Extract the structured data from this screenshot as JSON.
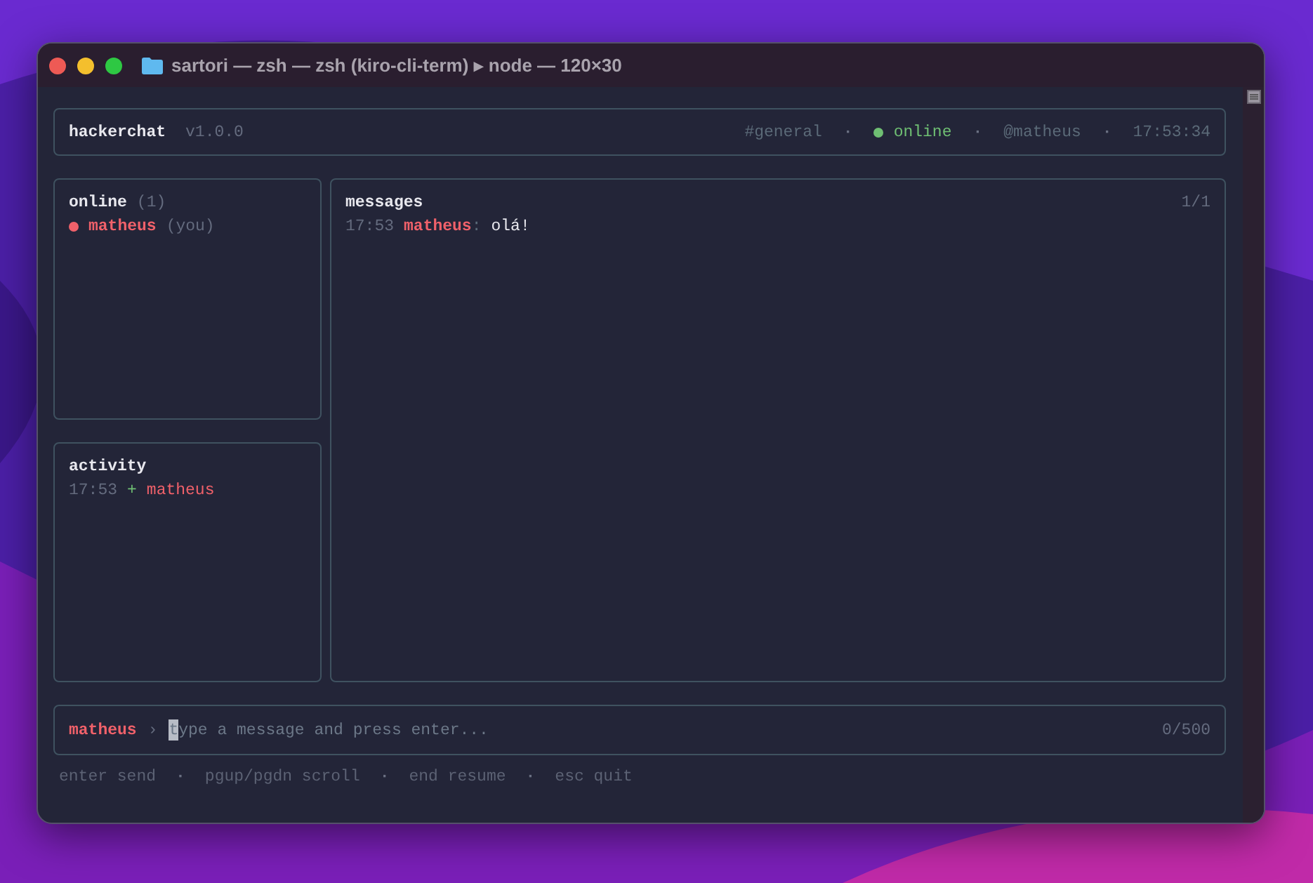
{
  "window": {
    "title": "sartori — zsh — zsh (kiro-cli-term) ▸ node — 120×30"
  },
  "header": {
    "app_name": "hackerchat",
    "version": "v1.0.0",
    "channel": "#general",
    "separator_1": "·",
    "status": "online",
    "status_on": true,
    "separator_2": "·",
    "user": "@matheus",
    "separator_3": "·",
    "time": "17:53:34"
  },
  "online_panel": {
    "title": "online",
    "count": "(1)",
    "users": [
      {
        "name": "matheus",
        "suffix": "(you)",
        "color": "#f0616a"
      }
    ]
  },
  "activity_panel": {
    "title": "activity",
    "events": [
      {
        "time": "17:53",
        "sign": "+",
        "name": "matheus"
      }
    ]
  },
  "messages_panel": {
    "title": "messages",
    "page": "1/1",
    "messages": [
      {
        "time": "17:53",
        "author": "matheus",
        "separator": ":",
        "text": "olá!"
      }
    ]
  },
  "input": {
    "user": "matheus",
    "prompt": "›",
    "placeholder": "type a message and press enter...",
    "counter": "0/500"
  },
  "footer": [
    {
      "kind": "hint",
      "text": "enter send"
    },
    {
      "kind": "sep",
      "text": "·"
    },
    {
      "kind": "hint",
      "text": "pgup/pgdn scroll"
    },
    {
      "kind": "sep",
      "text": "·"
    },
    {
      "kind": "hint",
      "text": "end resume"
    },
    {
      "kind": "sep",
      "text": "·"
    },
    {
      "kind": "hint",
      "text": "esc quit"
    }
  ]
}
